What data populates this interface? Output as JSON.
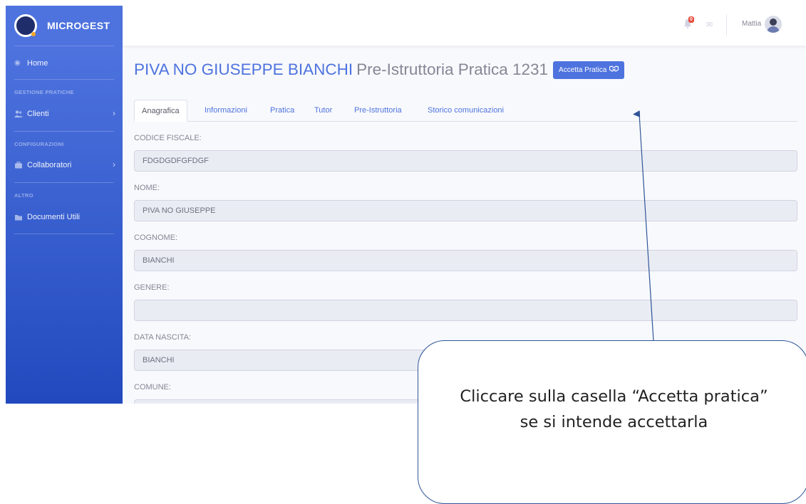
{
  "brand": {
    "name": "MICROGEST"
  },
  "sidebar": {
    "home_label": "Home",
    "sections": [
      {
        "heading": "GESTIONE PRATICHE",
        "items": [
          {
            "label": "Clienti",
            "icon": "users-icon",
            "chevron": "›"
          }
        ]
      },
      {
        "heading": "CONFIGURAZIONI",
        "items": [
          {
            "label": "Collaboratori",
            "icon": "briefcase-icon",
            "chevron": "›"
          }
        ]
      },
      {
        "heading": "ALTRO",
        "items": [
          {
            "label": "Documenti Utili",
            "icon": "folder-icon"
          }
        ]
      }
    ]
  },
  "topbar": {
    "notification_count": "0",
    "user_name": "Mattia"
  },
  "page": {
    "title_name": "PIVA NO GIUSEPPE BIANCHI",
    "title_rest": "Pre-Istruttoria Pratica 1231",
    "accept_button": "Accetta Pratica",
    "accept_icon": "handshake-icon"
  },
  "tabs": [
    "Anagrafica",
    "Informazioni",
    "Pratica",
    "Tutor",
    "Pre-Istruttoria",
    "Storico comunicazioni"
  ],
  "active_tab": "Anagrafica",
  "fields": [
    {
      "label": "CODICE FISCALE:",
      "value": "FDGDGDFGFDGF"
    },
    {
      "label": "NOME:",
      "value": "PIVA NO GIUSEPPE"
    },
    {
      "label": "COGNOME:",
      "value": "BIANCHI"
    },
    {
      "label": "GENERE:",
      "value": ""
    },
    {
      "label": "DATA NASCITA:",
      "value": "BIANCHI"
    },
    {
      "label": "COMUNE:",
      "value": ""
    }
  ],
  "annotation": {
    "line1": "Cliccare sulla casella “Accetta pratica”",
    "line2": "se si intende accettarla"
  },
  "colors": {
    "primary": "#4e73df",
    "sidebar_gradient_end": "#224abe",
    "annotation_stroke": "#2f5597",
    "badge": "#e74a3b"
  }
}
